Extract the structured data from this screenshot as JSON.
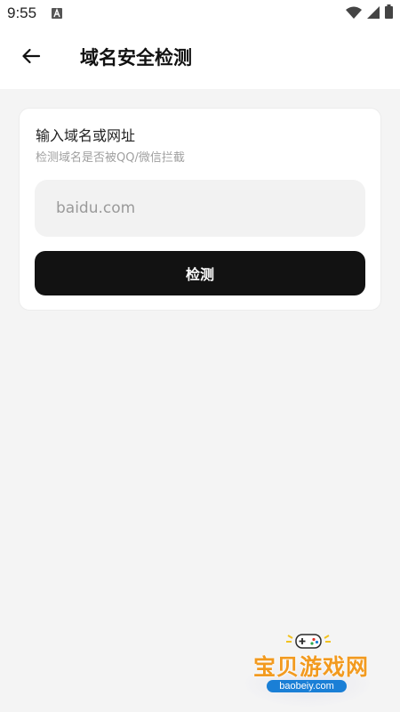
{
  "status_bar": {
    "time": "9:55"
  },
  "header": {
    "title": "域名安全检测"
  },
  "card": {
    "title": "输入域名或网址",
    "subtitle": "检测域名是否被QQ/微信拦截",
    "input_placeholder": "baidu.com",
    "input_value": "",
    "button_label": "检测"
  },
  "watermark": {
    "brand": "宝贝游戏网",
    "url": "baobeiy.com"
  },
  "colors": {
    "background": "#f4f4f4",
    "button": "#121212",
    "watermark_orange": "#f29a1f",
    "watermark_blue": "#1a7fd6"
  }
}
